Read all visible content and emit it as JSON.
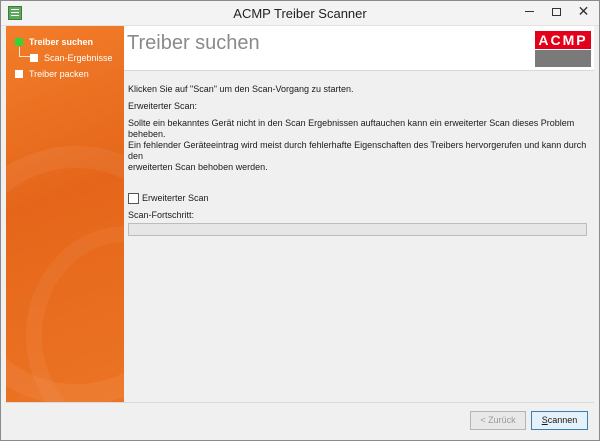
{
  "window": {
    "title": "ACMP Treiber Scanner",
    "controls": {
      "minimize": "minimize-icon",
      "maximize": "maximize-icon",
      "close": "✕"
    }
  },
  "sidebar": {
    "steps": [
      {
        "label": "Treiber suchen",
        "state": "active"
      },
      {
        "label": "Scan-Ergebnisse",
        "state": "pending"
      },
      {
        "label": "Treiber packen",
        "state": "pending"
      }
    ]
  },
  "header": {
    "page_title": "Treiber suchen",
    "logo_text": "ACMP",
    "logo_colors": {
      "top": "#e3001b",
      "bottom": "#7a7a7a"
    }
  },
  "content": {
    "intro": "Klicken Sie auf \"Scan\" um den Scan-Vorgang zu starten.",
    "extended_scan_heading": "Erweiterter Scan:",
    "extended_scan_description": "Sollte ein bekanntes Gerät nicht in den Scan Ergebnissen auftauchen kann ein erweiterter Scan dieses Problem beheben.\nEin fehlender Geräteeintrag wird meist durch fehlerhafte Eigenschaften des Treibers hervorgerufen und kann durch den\nerweiterten Scan behoben werden.",
    "checkbox_label": "Erweiterter Scan",
    "checkbox_checked": false,
    "progress_label": "Scan-Fortschritt:",
    "progress_value": 0
  },
  "footer": {
    "back_button": "< Zurück",
    "back_enabled": false,
    "scan_button_first": "S",
    "scan_button_rest": "cannen"
  },
  "colors": {
    "sidebar_orange": "#ec7424",
    "active_step": "#35d335",
    "progress_fill": "#06b025"
  }
}
